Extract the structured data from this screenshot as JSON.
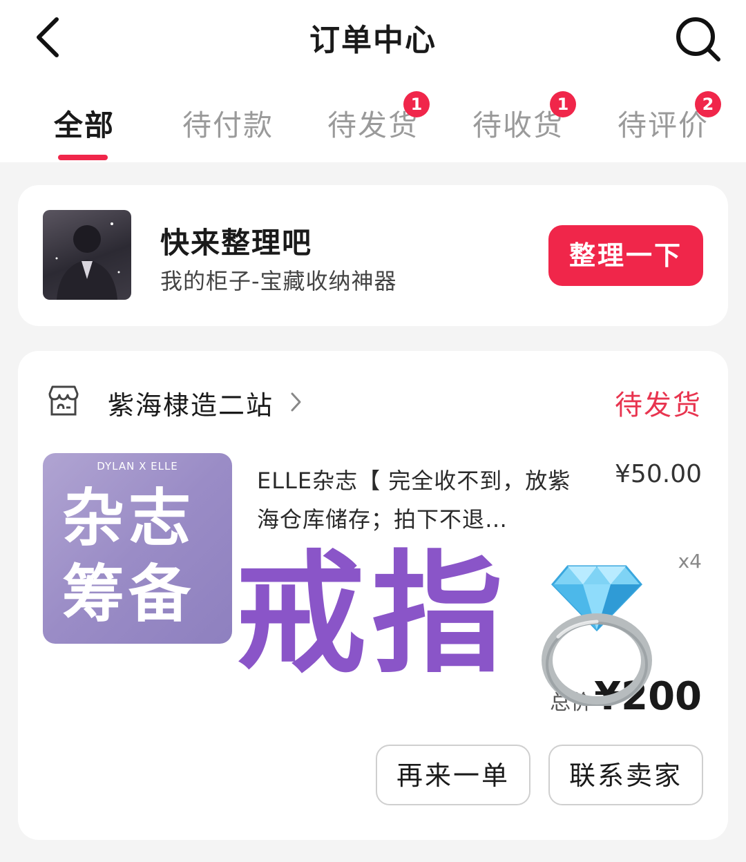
{
  "header": {
    "title": "订单中心"
  },
  "tabs": [
    {
      "label": "全部",
      "badge": ""
    },
    {
      "label": "待付款",
      "badge": ""
    },
    {
      "label": "待发货",
      "badge": "1"
    },
    {
      "label": "待收货",
      "badge": "1"
    },
    {
      "label": "待评价",
      "badge": "2"
    }
  ],
  "promo": {
    "title": "快来整理吧",
    "subtitle": "我的柜子-宝藏收纳神器",
    "button": "整理一下"
  },
  "order": {
    "shop_name": "紫海棣造二站",
    "status": "待发货",
    "cover": {
      "brand": "DYLAN X ELLE",
      "line1": "杂志",
      "line2": "筹备"
    },
    "product_title": "ELLE杂志【 完全收不到，放紫海仓库储存；拍下不退…",
    "price": "¥50.00",
    "quantity": "x4",
    "total_label": "总价",
    "total_value": "¥200",
    "buttons": {
      "reorder": "再来一单",
      "contact": "联系卖家"
    }
  },
  "sticker": {
    "text": "戒指",
    "icon": "ring-icon"
  },
  "colors": {
    "accent": "#f0264a",
    "status": "#e8344f",
    "sticker_purple": "#8a55c8"
  }
}
